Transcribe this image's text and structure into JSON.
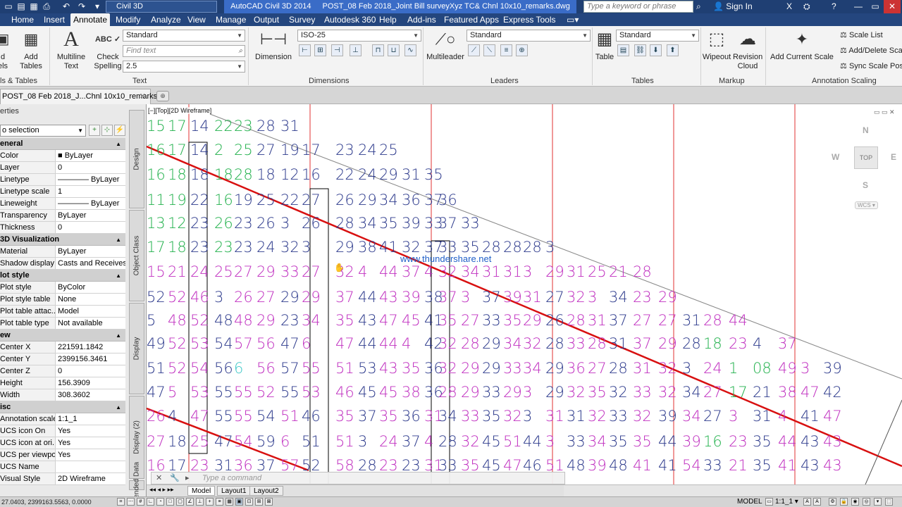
{
  "titlebar": {
    "workspace": "Civil 3D",
    "app_name": "AutoCAD Civil 3D 2014",
    "file_name": "POST_08 Feb 2018_Joint Bill surveyXyz TC& Chnl 10x10_remarks.dwg",
    "search_placeholder": "Type a keyword or phrase",
    "sign_in": "Sign In"
  },
  "menu": [
    "Home",
    "Insert",
    "Annotate",
    "Modify",
    "Analyze",
    "View",
    "Manage",
    "Output",
    "Survey",
    "Autodesk 360",
    "Help",
    "Add-ins",
    "Featured Apps",
    "Express Tools"
  ],
  "active_menu": "Annotate",
  "ribbon": {
    "tables_group": {
      "labels_btn": "d\nels",
      "add_tables": "Add\nTables",
      "label": "ls & Tables"
    },
    "text_group": {
      "multiline_text": "Multiline\nText",
      "check_spelling": "Check\nSpelling",
      "style": "Standard",
      "find_placeholder": "Find text",
      "height": "2.5",
      "label": "Text"
    },
    "dimensions_group": {
      "dimension": "Dimension",
      "style": "ISO-25",
      "label": "Dimensions"
    },
    "leaders_group": {
      "multileader": "Multileader",
      "style": "Standard",
      "label": "Leaders"
    },
    "tables2_group": {
      "table": "Table",
      "style": "Standard",
      "label": "Tables"
    },
    "markup_group": {
      "wipeout": "Wipeout",
      "revision_cloud": "Revision\nCloud",
      "label": "Markup"
    },
    "scaling_group": {
      "add_current_scale": "Add Current Scale",
      "scale_list": "Scale List",
      "add_delete": "Add/Delete Sca",
      "sync": "Sync Scale Posi",
      "label": "Annotation Scaling"
    }
  },
  "doc_tab": "POST_08 Feb 2018_J...Chnl 10x10_remarks*",
  "properties": {
    "title": "erties",
    "selection": "o selection",
    "sections": [
      {
        "name": "eneral",
        "rows": [
          [
            "Color",
            "■ ByLayer"
          ],
          [
            "Layer",
            "0"
          ],
          [
            "Linetype",
            "———— ByLayer"
          ],
          [
            "Linetype scale",
            "1"
          ],
          [
            "Lineweight",
            "———— ByLayer"
          ],
          [
            "Transparency",
            "ByLayer"
          ],
          [
            "Thickness",
            "0"
          ]
        ]
      },
      {
        "name": "3D Visualization",
        "rows": [
          [
            "Material",
            "ByLayer"
          ],
          [
            "Shadow display",
            "Casts and Receives ..."
          ]
        ]
      },
      {
        "name": "lot style",
        "rows": [
          [
            "Plot style",
            "ByColor"
          ],
          [
            "Plot style table",
            "None"
          ],
          [
            "Plot table attac...",
            "Model"
          ],
          [
            "Plot table type",
            "Not available"
          ]
        ]
      },
      {
        "name": "ew",
        "rows": [
          [
            "Center X",
            "221591.1842"
          ],
          [
            "Center Y",
            "2399156.3461"
          ],
          [
            "Center Z",
            "0"
          ],
          [
            "Height",
            "156.3909"
          ],
          [
            "Width",
            "308.3602"
          ]
        ]
      },
      {
        "name": "isc",
        "rows": [
          [
            "Annotation scale",
            "1:1_1"
          ],
          [
            "UCS icon On",
            "Yes"
          ],
          [
            "UCS icon at ori...",
            "Yes"
          ],
          [
            "UCS per viewpo...",
            "Yes"
          ],
          [
            "UCS Name",
            ""
          ],
          [
            "Visual Style",
            "2D Wireframe"
          ]
        ]
      }
    ],
    "vertical_tabs": [
      "Design",
      "Object Class",
      "Display",
      "Display (2)",
      "Extended Data"
    ]
  },
  "viewport": {
    "label": "[−][Top][2D Wireframe]",
    "watermark": "www.thundershare.net",
    "viewcube": {
      "n": "N",
      "s": "S",
      "e": "E",
      "w": "W",
      "top": "TOP",
      "wcs": "WCS"
    },
    "command_placeholder": "Type a command"
  },
  "drawing_numbers": [
    [
      "15",
      "17",
      "14",
      "22",
      "23",
      "28",
      "31",
      "",
      "",
      "",
      "",
      "",
      "",
      "",
      "",
      "",
      "",
      "",
      "",
      "",
      "",
      ""
    ],
    [
      "16",
      "17",
      "14",
      "2",
      "25",
      "27",
      "19",
      "17",
      "23",
      "24",
      "25",
      "",
      "",
      "",
      "",
      "",
      "",
      "",
      "",
      "",
      "",
      ""
    ],
    [
      "16",
      "18",
      "18",
      "18",
      "28",
      "18",
      "12",
      "16",
      "22",
      "24",
      "29",
      "31",
      "35",
      "",
      "",
      "",
      "",
      "",
      "",
      "",
      "",
      ""
    ],
    [
      "11",
      "19",
      "22",
      "16",
      "19",
      "25",
      "22",
      "27",
      "26",
      "29",
      "34",
      "36",
      "37",
      "36",
      "",
      "",
      "",
      "",
      "",
      "",
      "",
      ""
    ],
    [
      "13",
      "12",
      "23",
      "26",
      "23",
      "26",
      "3",
      "26",
      "28",
      "34",
      "35",
      "39",
      "33",
      "37",
      "33",
      "",
      "",
      "",
      "",
      "",
      "",
      ""
    ],
    [
      "17",
      "18",
      "23",
      "23",
      "23",
      "24",
      "32",
      "3",
      "29",
      "38",
      "41",
      "32",
      "37",
      "33",
      "35",
      "28",
      "28",
      "28",
      "3",
      "",
      "",
      ""
    ],
    [
      "15",
      "21",
      "24",
      "25",
      "27",
      "29",
      "33",
      "27",
      "32",
      "4",
      "44",
      "37",
      "4",
      "32",
      "34",
      "31",
      "31",
      "3",
      "29",
      "31",
      "25",
      "21",
      "28"
    ],
    [
      "52",
      "52",
      "46",
      "3",
      "26",
      "27",
      "29",
      "29",
      "37",
      "44",
      "43",
      "39",
      "38",
      "37",
      "3",
      "37",
      "39",
      "31",
      "27",
      "32",
      "3",
      "34",
      "23",
      "29"
    ],
    [
      "5",
      "48",
      "52",
      "48",
      "48",
      "29",
      "23",
      "34",
      "35",
      "43",
      "47",
      "45",
      "41",
      "35",
      "27",
      "33",
      "35",
      "29",
      "26",
      "28",
      "31",
      "37",
      "27",
      "27",
      "31",
      "28",
      "44"
    ],
    [
      "49",
      "52",
      "53",
      "54",
      "57",
      "56",
      "47",
      "6",
      "47",
      "44",
      "44",
      "4",
      "42",
      "32",
      "28",
      "29",
      "34",
      "32",
      "28",
      "33",
      "28",
      "31",
      "37",
      "29",
      "28",
      "18",
      "23",
      "4",
      "37"
    ],
    [
      "51",
      "52",
      "54",
      "56",
      "6",
      "56",
      "57",
      "55",
      "51",
      "53",
      "43",
      "35",
      "36",
      "32",
      "29",
      "29",
      "33",
      "34",
      "29",
      "36",
      "27",
      "28",
      "31",
      "32",
      "3",
      "24",
      "1",
      "08",
      "49",
      "3",
      "39"
    ],
    [
      "47",
      "5",
      "53",
      "55",
      "55",
      "52",
      "55",
      "53",
      "46",
      "45",
      "45",
      "38",
      "36",
      "28",
      "29",
      "33",
      "29",
      "3",
      "29",
      "32",
      "35",
      "32",
      "33",
      "32",
      "34",
      "27",
      "17",
      "21",
      "38",
      "47",
      "42"
    ],
    [
      "26",
      "4",
      "47",
      "55",
      "55",
      "54",
      "51",
      "46",
      "35",
      "37",
      "35",
      "36",
      "31",
      "34",
      "33",
      "35",
      "32",
      "3",
      "31",
      "31",
      "32",
      "33",
      "32",
      "39",
      "34",
      "27",
      "3",
      "31",
      "4",
      "41",
      "47"
    ],
    [
      "27",
      "18",
      "25",
      "47",
      "54",
      "59",
      "6",
      "51",
      "51",
      "3",
      "24",
      "37",
      "4",
      "28",
      "32",
      "45",
      "51",
      "44",
      "3",
      "33",
      "34",
      "35",
      "35",
      "44",
      "39",
      "16",
      "23",
      "35",
      "44",
      "43",
      "43"
    ],
    [
      "16",
      "17",
      "23",
      "31",
      "36",
      "37",
      "57",
      "52",
      "58",
      "28",
      "23",
      "23",
      "31",
      "33",
      "35",
      "45",
      "47",
      "46",
      "51",
      "48",
      "39",
      "48",
      "41",
      "41",
      "54",
      "33",
      "21",
      "35",
      "41",
      "43",
      "43"
    ]
  ],
  "layout_tabs": [
    "Model",
    "Layout1",
    "Layout2"
  ],
  "statusbar": {
    "coords": "27.0403, 2399163.5563, 0.0000",
    "model": "MODEL",
    "scale": "1:1_1"
  }
}
